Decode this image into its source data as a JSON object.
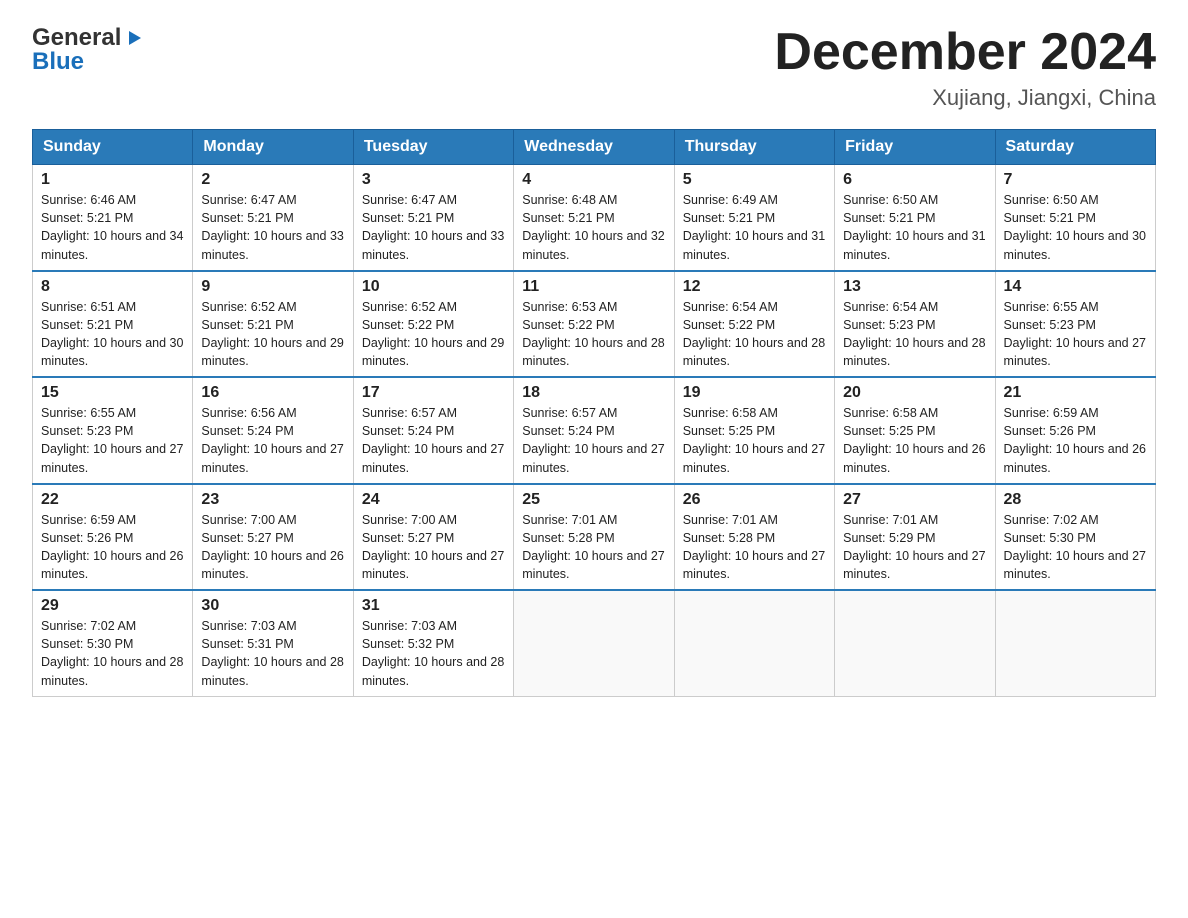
{
  "header": {
    "logo_line1": "General",
    "logo_line2": "Blue",
    "month_title": "December 2024",
    "location": "Xujiang, Jiangxi, China"
  },
  "days_of_week": [
    "Sunday",
    "Monday",
    "Tuesday",
    "Wednesday",
    "Thursday",
    "Friday",
    "Saturday"
  ],
  "weeks": [
    [
      {
        "day": "1",
        "sunrise": "6:46 AM",
        "sunset": "5:21 PM",
        "daylight": "10 hours and 34 minutes."
      },
      {
        "day": "2",
        "sunrise": "6:47 AM",
        "sunset": "5:21 PM",
        "daylight": "10 hours and 33 minutes."
      },
      {
        "day": "3",
        "sunrise": "6:47 AM",
        "sunset": "5:21 PM",
        "daylight": "10 hours and 33 minutes."
      },
      {
        "day": "4",
        "sunrise": "6:48 AM",
        "sunset": "5:21 PM",
        "daylight": "10 hours and 32 minutes."
      },
      {
        "day": "5",
        "sunrise": "6:49 AM",
        "sunset": "5:21 PM",
        "daylight": "10 hours and 31 minutes."
      },
      {
        "day": "6",
        "sunrise": "6:50 AM",
        "sunset": "5:21 PM",
        "daylight": "10 hours and 31 minutes."
      },
      {
        "day": "7",
        "sunrise": "6:50 AM",
        "sunset": "5:21 PM",
        "daylight": "10 hours and 30 minutes."
      }
    ],
    [
      {
        "day": "8",
        "sunrise": "6:51 AM",
        "sunset": "5:21 PM",
        "daylight": "10 hours and 30 minutes."
      },
      {
        "day": "9",
        "sunrise": "6:52 AM",
        "sunset": "5:21 PM",
        "daylight": "10 hours and 29 minutes."
      },
      {
        "day": "10",
        "sunrise": "6:52 AM",
        "sunset": "5:22 PM",
        "daylight": "10 hours and 29 minutes."
      },
      {
        "day": "11",
        "sunrise": "6:53 AM",
        "sunset": "5:22 PM",
        "daylight": "10 hours and 28 minutes."
      },
      {
        "day": "12",
        "sunrise": "6:54 AM",
        "sunset": "5:22 PM",
        "daylight": "10 hours and 28 minutes."
      },
      {
        "day": "13",
        "sunrise": "6:54 AM",
        "sunset": "5:23 PM",
        "daylight": "10 hours and 28 minutes."
      },
      {
        "day": "14",
        "sunrise": "6:55 AM",
        "sunset": "5:23 PM",
        "daylight": "10 hours and 27 minutes."
      }
    ],
    [
      {
        "day": "15",
        "sunrise": "6:55 AM",
        "sunset": "5:23 PM",
        "daylight": "10 hours and 27 minutes."
      },
      {
        "day": "16",
        "sunrise": "6:56 AM",
        "sunset": "5:24 PM",
        "daylight": "10 hours and 27 minutes."
      },
      {
        "day": "17",
        "sunrise": "6:57 AM",
        "sunset": "5:24 PM",
        "daylight": "10 hours and 27 minutes."
      },
      {
        "day": "18",
        "sunrise": "6:57 AM",
        "sunset": "5:24 PM",
        "daylight": "10 hours and 27 minutes."
      },
      {
        "day": "19",
        "sunrise": "6:58 AM",
        "sunset": "5:25 PM",
        "daylight": "10 hours and 27 minutes."
      },
      {
        "day": "20",
        "sunrise": "6:58 AM",
        "sunset": "5:25 PM",
        "daylight": "10 hours and 26 minutes."
      },
      {
        "day": "21",
        "sunrise": "6:59 AM",
        "sunset": "5:26 PM",
        "daylight": "10 hours and 26 minutes."
      }
    ],
    [
      {
        "day": "22",
        "sunrise": "6:59 AM",
        "sunset": "5:26 PM",
        "daylight": "10 hours and 26 minutes."
      },
      {
        "day": "23",
        "sunrise": "7:00 AM",
        "sunset": "5:27 PM",
        "daylight": "10 hours and 26 minutes."
      },
      {
        "day": "24",
        "sunrise": "7:00 AM",
        "sunset": "5:27 PM",
        "daylight": "10 hours and 27 minutes."
      },
      {
        "day": "25",
        "sunrise": "7:01 AM",
        "sunset": "5:28 PM",
        "daylight": "10 hours and 27 minutes."
      },
      {
        "day": "26",
        "sunrise": "7:01 AM",
        "sunset": "5:28 PM",
        "daylight": "10 hours and 27 minutes."
      },
      {
        "day": "27",
        "sunrise": "7:01 AM",
        "sunset": "5:29 PM",
        "daylight": "10 hours and 27 minutes."
      },
      {
        "day": "28",
        "sunrise": "7:02 AM",
        "sunset": "5:30 PM",
        "daylight": "10 hours and 27 minutes."
      }
    ],
    [
      {
        "day": "29",
        "sunrise": "7:02 AM",
        "sunset": "5:30 PM",
        "daylight": "10 hours and 28 minutes."
      },
      {
        "day": "30",
        "sunrise": "7:03 AM",
        "sunset": "5:31 PM",
        "daylight": "10 hours and 28 minutes."
      },
      {
        "day": "31",
        "sunrise": "7:03 AM",
        "sunset": "5:32 PM",
        "daylight": "10 hours and 28 minutes."
      },
      null,
      null,
      null,
      null
    ]
  ]
}
